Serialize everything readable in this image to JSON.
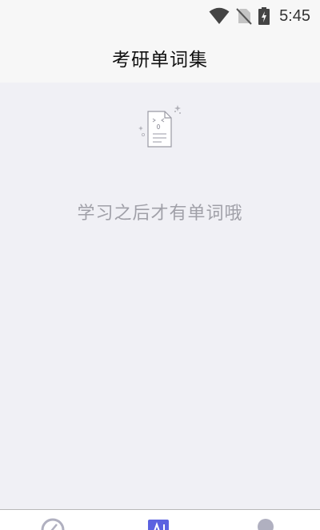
{
  "status_bar": {
    "time": "5:45",
    "icons": [
      "wifi-icon",
      "no-sim-icon",
      "battery-charging-icon"
    ]
  },
  "header": {
    "title": "考研单词集"
  },
  "main": {
    "empty_state": {
      "icon": "empty-document-icon",
      "message": "学习之后才有单词哦"
    }
  },
  "bottom_nav": {
    "items": [
      {
        "icon": "home-icon"
      },
      {
        "icon": "ai-icon",
        "active": true
      },
      {
        "icon": "profile-icon"
      }
    ]
  },
  "colors": {
    "background": "#f0f0f5",
    "header": "#f7f7f7",
    "accent": "#5b62e0",
    "inactive_icon": "#b0b0c0",
    "message_text": "#a0a0a8"
  }
}
